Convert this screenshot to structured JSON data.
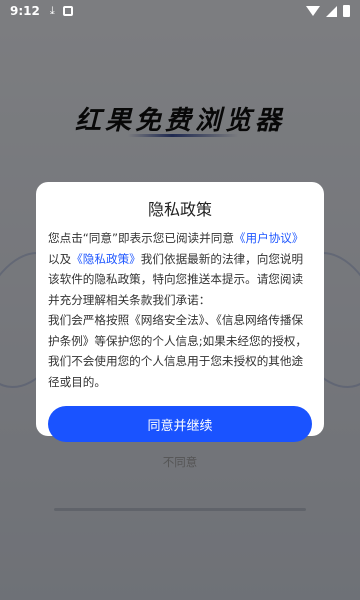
{
  "status_bar": {
    "time": "9:12",
    "icons_left": [
      "download-icon",
      "notification-icon"
    ],
    "icons_right": [
      "wifi-icon",
      "signal-icon",
      "battery-icon"
    ]
  },
  "app": {
    "title": "红果免费浏览器"
  },
  "dialog": {
    "title": "隐私政策",
    "text_1": "您点击“同意”即表示您已阅读并同意",
    "link_user_agreement": "《用户协议》",
    "text_2": "以及",
    "link_privacy_policy": "《隐私政策》",
    "text_3": "我们依据最新的法律，向您说明该软件的隐私政策，特向您推送本提示。请您阅读并充分理解相关条款我们承诺：",
    "text_4": "我们会严格按照《网络安全法》、《信息网络传播保护条例》等保护您的个人信息;如果未经您的授权，我们不会使用您的个人信息用于您未授权的其他途径或目的。",
    "agree_button": "同意并继续",
    "disagree_link": "不同意"
  },
  "colors": {
    "accent": "#1a53ff",
    "link": "#1f57ff"
  }
}
